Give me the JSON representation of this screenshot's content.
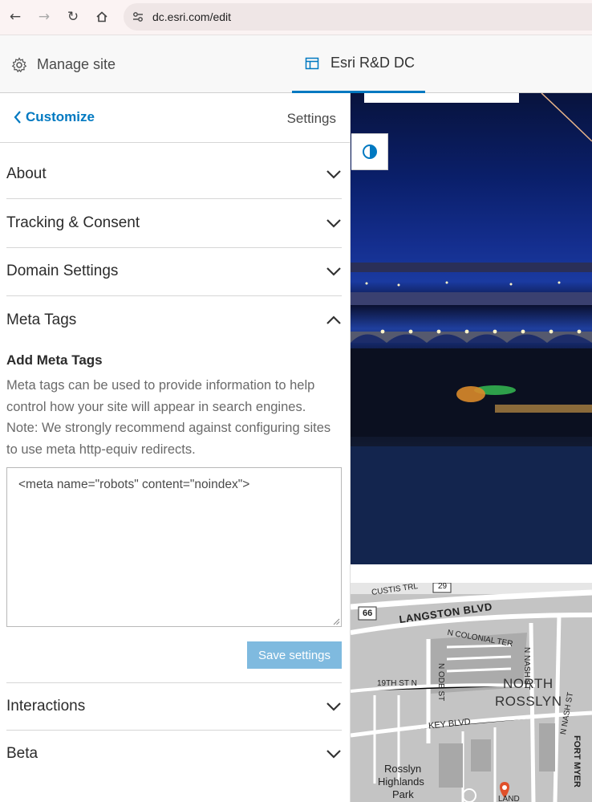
{
  "browser": {
    "url": "dc.esri.com/edit"
  },
  "app_bar": {
    "manage_label": "Manage site",
    "site_tab_label": "Esri R&D DC"
  },
  "panel": {
    "back_label": "Customize",
    "settings_label": "Settings",
    "sections": {
      "about": "About",
      "tracking": "Tracking & Consent",
      "domain": "Domain Settings",
      "meta": "Meta Tags",
      "interactions": "Interactions",
      "beta": "Beta"
    },
    "meta": {
      "title": "Add Meta Tags",
      "description": "Meta tags can be used to provide information to help control how your site will appear in search engines. Note: We strongly recommend against configuring sites to use meta http-equiv redirects.",
      "value": "<meta name=\"robots\" content=\"noindex\">",
      "save_label": "Save settings"
    }
  },
  "map": {
    "labels": {
      "custis": "CUSTIS TRL",
      "route29": "29",
      "route66": "66",
      "langston": "LANGSTON BLVD",
      "colonial": "N COLONIAL TER",
      "nash1": "N NASH ST",
      "nash2": "N NASH ST",
      "ode": "N ODE ST",
      "nineteenth": "19TH ST N",
      "north": "NORTH",
      "rosslyn": "ROSSLYN",
      "key": "KEY BLVD",
      "park1": "Rosslyn",
      "park2": "Highlands",
      "park3": "Park",
      "fortmyer": "FORT MYER",
      "land": "LAND"
    }
  },
  "colors": {
    "accent": "#0079c1",
    "save_disabled": "#7fbadf"
  }
}
